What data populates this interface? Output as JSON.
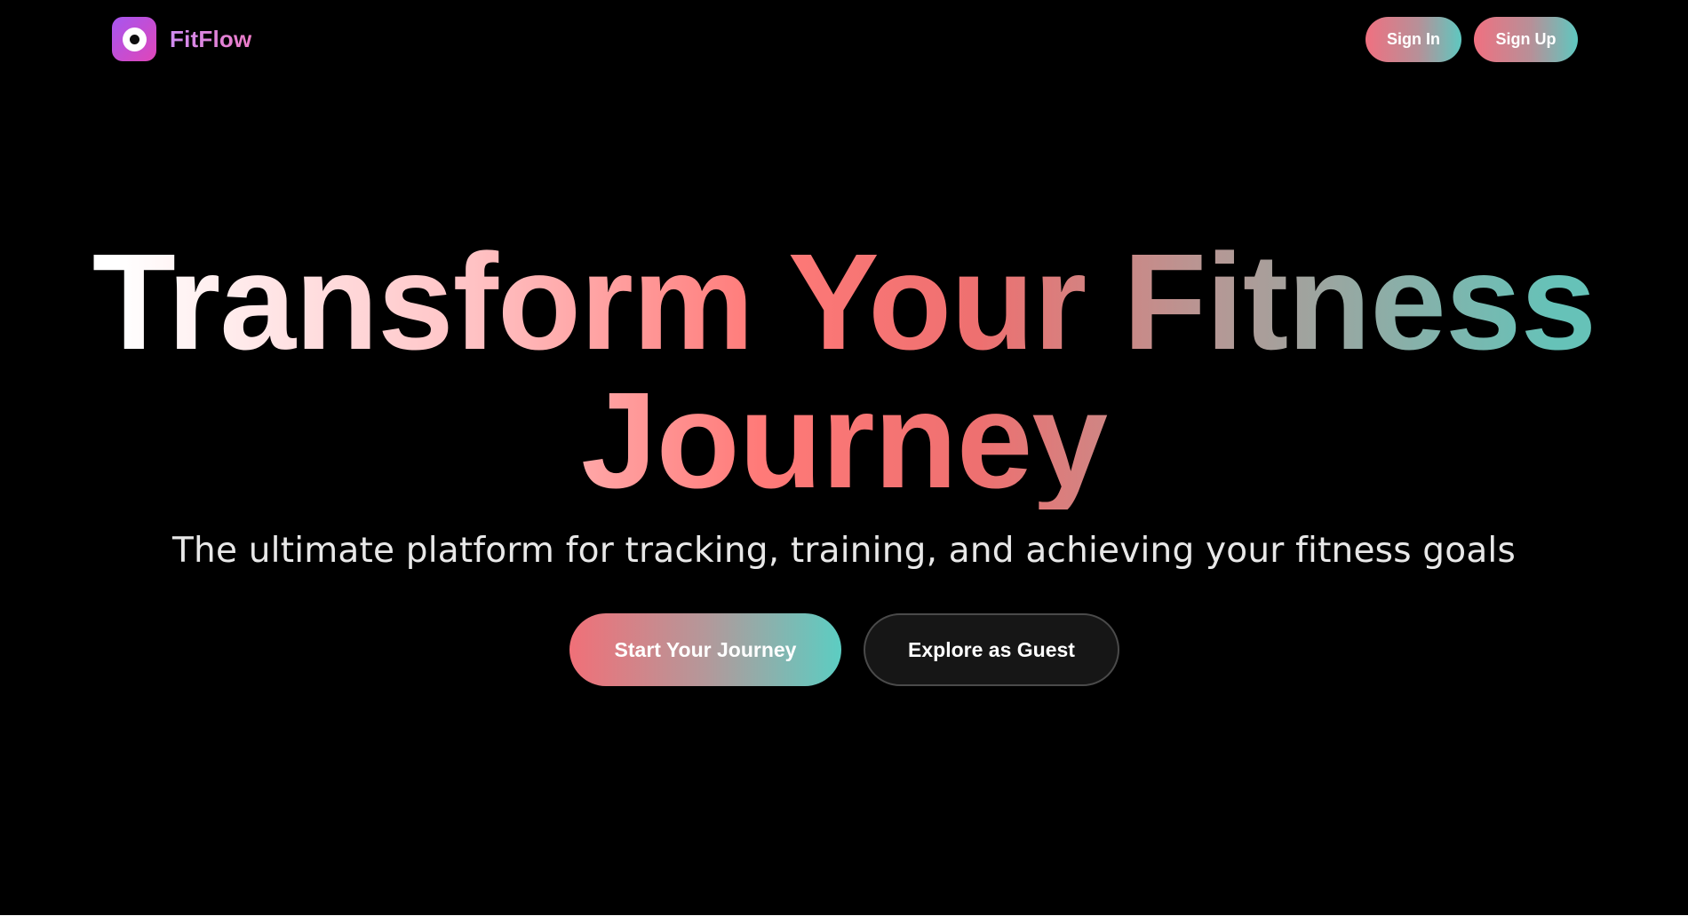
{
  "nav": {
    "brand": "FitFlow",
    "logo_icon": "target-icon",
    "sign_in_label": "Sign In",
    "sign_up_label": "Sign Up"
  },
  "hero": {
    "title_line1": "Transform Your Fitness",
    "title_line2": "Journey",
    "subtitle": "The ultimate platform for tracking, training, and achieving your fitness goals",
    "primary_cta": "Start Your Journey",
    "secondary_cta": "Explore as Guest"
  },
  "colors": {
    "background": "#000000",
    "accent_coral": "#f07078",
    "accent_teal": "#5ccdc2",
    "logo_purple": "#a656f0",
    "logo_pink": "#e046b8"
  }
}
